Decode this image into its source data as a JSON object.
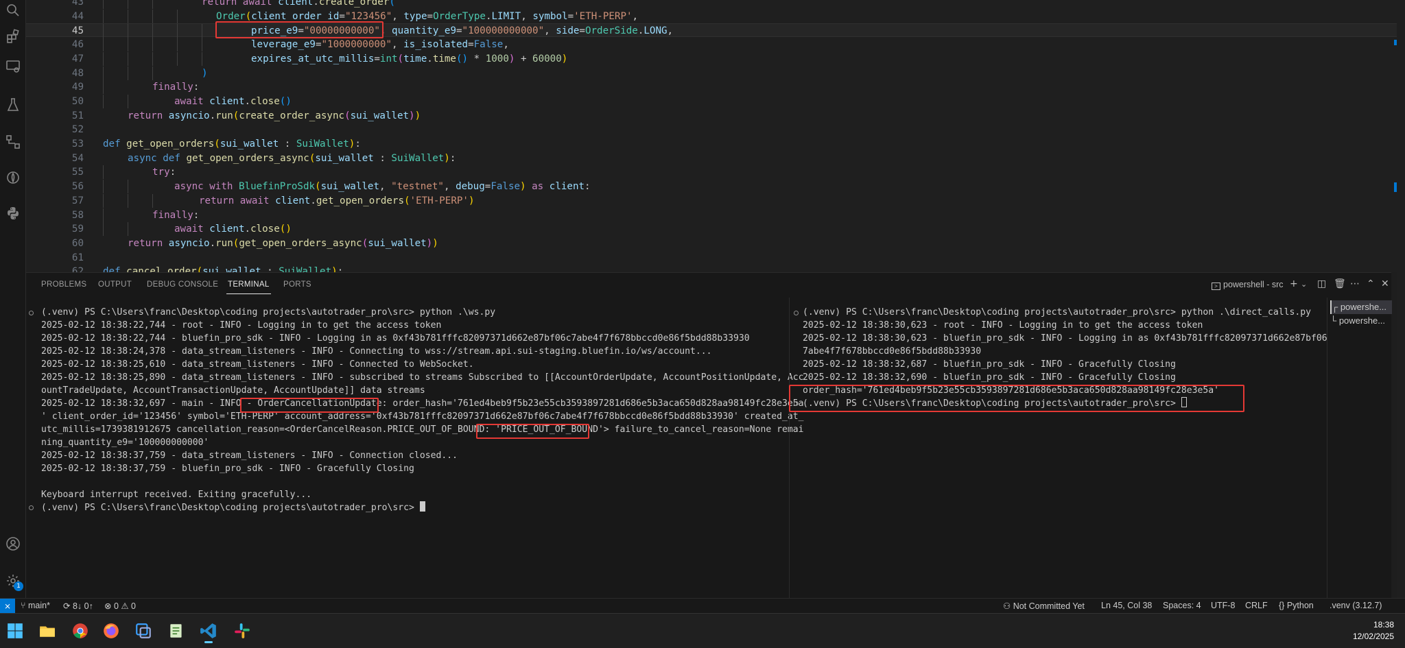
{
  "editor": {
    "active_line": "45",
    "lines": [
      {
        "n": "43",
        "html": "<span class=\"kw2\">return</span> <span class=\"kw2\">await</span> <span class=\"var\">client</span>.<span class=\"fn\">create_order</span><span class=\"br3\">(</span>",
        "indent": 144
      },
      {
        "n": "44",
        "html": "<span class=\"cls\">Order</span><span class=\"br\">(</span><span class=\"var\">client_order_id</span>=<span class=\"str\">\"123456\"</span>, <span class=\"var\">type</span>=<span class=\"cls\">OrderType</span>.<span class=\"var\">LIMIT</span>, <span class=\"var\">symbol</span>=<span class=\"str\">'ETH-PERP'</span>,",
        "indent": 165
      },
      {
        "n": "45",
        "html": "<span class=\"var\">price_e9</span>=<span class=\"str\">\"00000000000\"</span>, <span class=\"var\">quantity_e9</span>=<span class=\"str\">\"100000000000\"</span>, <span class=\"var\">side</span>=<span class=\"cls\">OrderSide</span>.<span class=\"var\">LONG</span>,",
        "indent": 216
      },
      {
        "n": "46",
        "html": "<span class=\"var\">leverage_e9</span>=<span class=\"str\">\"1000000000\"</span>, <span class=\"var\">is_isolated</span>=<span class=\"kw\">False</span>,",
        "indent": 216
      },
      {
        "n": "47",
        "html": "<span class=\"var\">expires_at_utc_millis</span>=<span class=\"cls\">int</span><span class=\"br2\">(</span><span class=\"var\">time</span>.<span class=\"fn\">time</span><span class=\"br3\">()</span> * <span class=\"num\">1000</span><span class=\"br2\">)</span> + <span class=\"num\">60000</span><span class=\"br\">)</span>",
        "indent": 216
      },
      {
        "n": "48",
        "html": "<span class=\"br3\">)</span>",
        "indent": 144
      },
      {
        "n": "49",
        "html": "<span class=\"kw2\">finally</span>:",
        "indent": 72
      },
      {
        "n": "50",
        "html": "<span class=\"kw2\">await</span> <span class=\"var\">client</span>.<span class=\"fn\">close</span><span class=\"br3\">()</span>",
        "indent": 104
      },
      {
        "n": "51",
        "html": "<span class=\"kw2\">return</span> <span class=\"var\">asyncio</span>.<span class=\"fn\">run</span><span class=\"br\">(</span><span class=\"fn\">create_order_async</span><span class=\"br2\">(</span><span class=\"var\">sui_wallet</span><span class=\"br2\">)</span><span class=\"br\">)</span>",
        "indent": 36
      },
      {
        "n": "52",
        "html": "",
        "indent": 0
      },
      {
        "n": "53",
        "html": "<span class=\"kw\">def</span> <span class=\"fn\">get_open_orders</span><span class=\"br\">(</span><span class=\"var\">sui_wallet</span> : <span class=\"cls\">SuiWallet</span><span class=\"br\">)</span>:",
        "indent": 0
      },
      {
        "n": "54",
        "html": "<span class=\"kw\">async</span> <span class=\"kw\">def</span> <span class=\"fn\">get_open_orders_async</span><span class=\"br\">(</span><span class=\"var\">sui_wallet</span> : <span class=\"cls\">SuiWallet</span><span class=\"br\">)</span>:",
        "indent": 36
      },
      {
        "n": "55",
        "html": "<span class=\"kw2\">try</span>:",
        "indent": 72
      },
      {
        "n": "56",
        "html": "<span class=\"kw2\">async</span> <span class=\"kw2\">with</span> <span class=\"cls\">BluefinProSdk</span><span class=\"br\">(</span><span class=\"var\">sui_wallet</span>, <span class=\"str\">\"testnet\"</span>, <span class=\"var\">debug</span>=<span class=\"kw\">False</span><span class=\"br\">)</span> <span class=\"kw2\">as</span> <span class=\"var\">client</span>:",
        "indent": 104
      },
      {
        "n": "57",
        "html": "<span class=\"kw2\">return</span> <span class=\"kw2\">await</span> <span class=\"var\">client</span>.<span class=\"fn\">get_open_orders</span><span class=\"br\">(</span><span class=\"str\">'ETH-PERP'</span><span class=\"br\">)</span>",
        "indent": 140
      },
      {
        "n": "58",
        "html": "<span class=\"kw2\">finally</span>:",
        "indent": 72
      },
      {
        "n": "59",
        "html": "<span class=\"kw2\">await</span> <span class=\"var\">client</span>.<span class=\"fn\">close</span><span class=\"br\">()</span>",
        "indent": 104
      },
      {
        "n": "60",
        "html": "<span class=\"kw2\">return</span> <span class=\"var\">asyncio</span>.<span class=\"fn\">run</span><span class=\"br\">(</span><span class=\"fn\">get_open_orders_async</span><span class=\"br2\">(</span><span class=\"var\">sui_wallet</span><span class=\"br2\">)</span><span class=\"br\">)</span>",
        "indent": 36
      },
      {
        "n": "61",
        "html": "",
        "indent": 0
      },
      {
        "n": "62",
        "html": "<span class=\"kw\">def</span> <span class=\"fn\">cancel_order</span><span class=\"br\">(</span><span class=\"var\">sui_wallet</span> : <span class=\"cls\">SuiWallet</span><span class=\"br\">)</span>:",
        "indent": 0
      }
    ]
  },
  "panel": {
    "tabs": [
      "PROBLEMS",
      "OUTPUT",
      "DEBUG CONSOLE",
      "TERMINAL",
      "PORTS"
    ],
    "active_tab": "TERMINAL",
    "terminal_name": "powershell - src",
    "terminal_list": [
      "powershe...",
      "powershe..."
    ]
  },
  "terminal_left": [
    "(.venv) PS C:\\Users\\franc\\Desktop\\coding projects\\autotrader_pro\\src> python .\\ws.py",
    "2025-02-12 18:38:22,744 - root - INFO - Logging in to get the access token",
    "2025-02-12 18:38:22,744 - bluefin_pro_sdk - INFO - Logging in as 0xf43b781fffc82097371d662e87bf06c7abe4f7f678bbccd0e86f5bdd88b33930",
    "2025-02-12 18:38:24,378 - data_stream_listeners - INFO - Connecting to wss://stream.api.sui-staging.bluefin.io/ws/account...",
    "2025-02-12 18:38:25,610 - data_stream_listeners - INFO - Connected to WebSocket.",
    "2025-02-12 18:38:25,890 - data_stream_listeners - INFO - subscribed to streams Subscribed to [[AccountOrderUpdate, AccountPositionUpdate, Acc",
    "ountTradeUpdate, AccountTransactionUpdate, AccountUpdate]] data streams",
    "2025-02-12 18:38:32,697 - main - INFO - OrderCancellationUpdate: order_hash='761ed4beb9f5b23e55cb3593897281d686e5b3aca650d828aa98149fc28e3e5a",
    "' client_order_id='123456' symbol='ETH-PERP' account_address='0xf43b781fffc82097371d662e87bf06c7abe4f7f678bbccd0e86f5bdd88b33930' created_at_",
    "utc_millis=1739381912675 cancellation_reason=<OrderCancelReason.PRICE_OUT_OF_BOUND: 'PRICE_OUT_OF_BOUND'> failure_to_cancel_reason=None remai",
    "ning_quantity_e9='100000000000'",
    "2025-02-12 18:38:37,759 - data_stream_listeners - INFO - Connection closed...",
    "2025-02-12 18:38:37,759 - bluefin_pro_sdk - INFO - Gracefully Closing",
    "",
    "Keyboard interrupt received. Exiting gracefully...",
    "(.venv) PS C:\\Users\\franc\\Desktop\\coding projects\\autotrader_pro\\src> "
  ],
  "terminal_right": [
    "(.venv) PS C:\\Users\\franc\\Desktop\\coding projects\\autotrader_pro\\src> python .\\direct_calls.py",
    "2025-02-12 18:38:30,623 - root - INFO - Logging in to get the access token",
    "2025-02-12 18:38:30,623 - bluefin_pro_sdk - INFO - Logging in as 0xf43b781fffc82097371d662e87bf06c",
    "7abe4f7f678bbccd0e86f5bdd88b33930",
    "2025-02-12 18:38:32,687 - bluefin_pro_sdk - INFO - Gracefully Closing",
    "2025-02-12 18:38:32,690 - bluefin_pro_sdk - INFO - Gracefully Closing",
    "order_hash='761ed4beb9f5b23e55cb3593897281d686e5b3aca650d828aa98149fc28e3e5a'",
    "(.venv) PS C:\\Users\\franc\\Desktop\\coding projects\\autotrader_pro\\src> "
  ],
  "statusbar": {
    "branch": "main*",
    "sync": "8↓ 0↑",
    "problems": "⊗ 0 ⚠ 0",
    "not_committed": "Not Committed Yet",
    "position": "Ln 45, Col 38",
    "spaces": "Spaces: 4",
    "encoding": "UTF-8",
    "eol": "CRLF",
    "language": "{} Python",
    "interpreter": ".venv (3.12.7)"
  },
  "accounts_badge": "1",
  "taskbar": {
    "time": "18:38",
    "date": "12/02/2025"
  },
  "colors": {
    "highlight": "#e53935",
    "accent": "#0078d4"
  }
}
